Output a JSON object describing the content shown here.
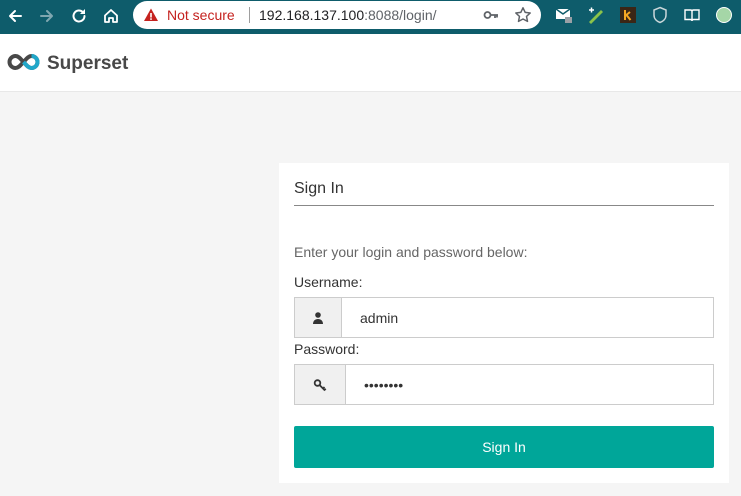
{
  "browser": {
    "omnibox": {
      "security_label": "Not secure",
      "url_host": "192.168.137.100",
      "url_rest": ":8088/login/"
    },
    "icons": [
      "back-icon",
      "forward-icon",
      "reload-icon",
      "home-icon",
      "warning-icon",
      "key-icon",
      "star-icon"
    ],
    "colors": {
      "chrome": "#0e5c6b",
      "warning": "#c5221f"
    }
  },
  "navbar": {
    "brand": "Superset"
  },
  "login": {
    "title": "Sign In",
    "prompt": "Enter your login and password below:",
    "username_label": "Username:",
    "username_value": "admin",
    "password_label": "Password:",
    "password_value": "••••••••",
    "submit_label": "Sign In",
    "colors": {
      "accent": "#00a699"
    }
  }
}
